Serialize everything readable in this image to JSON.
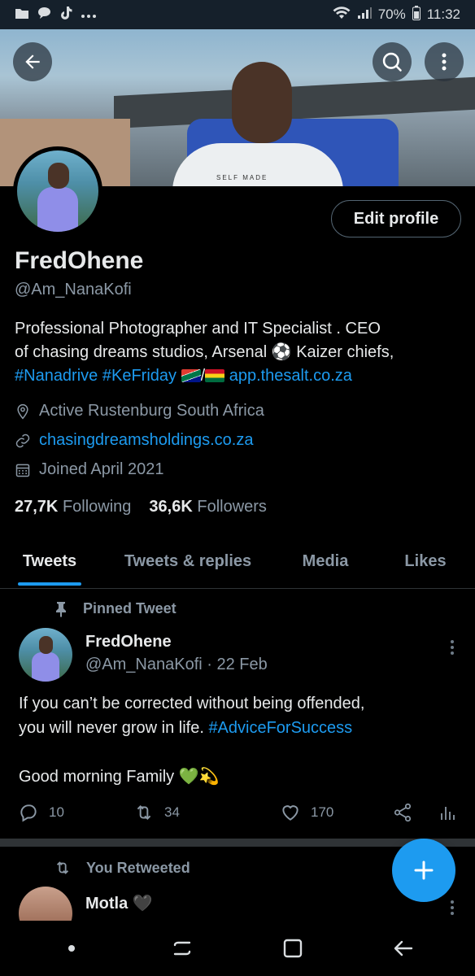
{
  "status_bar": {
    "battery": "70%",
    "time": "11:32",
    "icons": [
      "folder-icon",
      "chat-icon",
      "tiktok-icon",
      "more-dots-icon",
      "wifi-icon",
      "signal-icon",
      "battery-icon"
    ]
  },
  "banner": {
    "shirt_text": "SELF MADE"
  },
  "profile": {
    "edit_button": "Edit profile",
    "display_name": "FredOhene",
    "handle": "@Am_NanaKofi",
    "bio_line1": "Professional Photographer and IT Specialist . CEO",
    "bio_line2_a": "of chasing dreams studios, Arsenal ",
    "bio_line2_b": " Kaizer chiefs,",
    "bio_hashtag1": "#Nanadrive",
    "bio_hashtag2": "#KeFriday",
    "bio_slash": "/",
    "bio_link": "app.thesalt.co.za",
    "location": "Active Rustenburg South Africa",
    "website": "chasingdreamsholdings.co.za",
    "joined": "Joined April 2021",
    "following_count": "27,7K",
    "following_label": "Following",
    "followers_count": "36,6K",
    "followers_label": "Followers"
  },
  "tabs": [
    {
      "label": "Tweets",
      "active": true
    },
    {
      "label": "Tweets & replies",
      "active": false
    },
    {
      "label": "Media",
      "active": false
    },
    {
      "label": "Likes",
      "active": false
    }
  ],
  "pinned_tweet": {
    "context": "Pinned Tweet",
    "name": "FredOhene",
    "handle_date": "@Am_NanaKofi · 22 Feb",
    "text_line1": "If you can’t be corrected without being offended,",
    "text_line2": "you will never grow in life. ",
    "hashtag": "#AdviceForSuccess",
    "text_line3": "Good morning Family ",
    "replies": "10",
    "retweets": "34",
    "likes": "170"
  },
  "retweet": {
    "context": "You Retweeted",
    "name": "Motla"
  },
  "colors": {
    "accent": "#1d9bf0",
    "background": "#000000",
    "muted_text": "#8b98a5",
    "primary_text": "#e7e9ea"
  }
}
